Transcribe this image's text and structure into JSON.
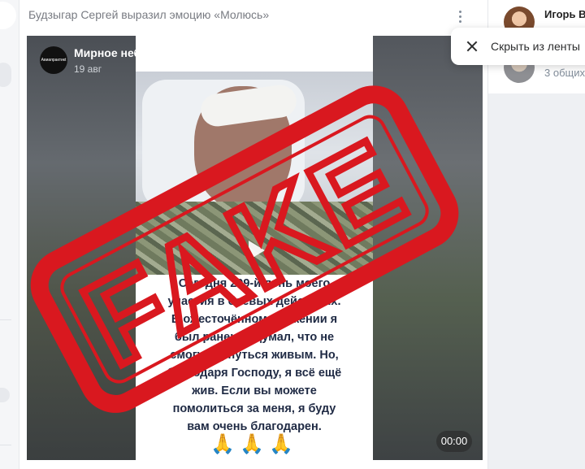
{
  "post": {
    "header_text": "Будзыгар Сергей выразил эмоцию «Молюсь»",
    "source_name": "Мирное небо",
    "source_date": "19 авг",
    "source_avatar_text": "Авиапрактикt",
    "caption_lines": [
      "Сегодня 299-й день моего",
      "участия в боевых действиях.",
      "В ожесточённом сражении я",
      "был ранен, и думал, что не",
      "смогу вернуться живым. Но,",
      "благодаря Господу, я всё ещё",
      "жив. Если вы можете",
      "помолиться за меня, я буду",
      "вам очень благодарен."
    ],
    "emoji": "🙏🙏🙏",
    "video_time": "00:00"
  },
  "stamp": {
    "text": "FAKE",
    "color": "#d9181f"
  },
  "menu": {
    "hide_label": "Скрыть из ленты"
  },
  "friend": {
    "name": "Игорь В",
    "mutual": "3 общих"
  },
  "colors": {
    "accent": "#2c2d2e",
    "muted": "#818c99"
  }
}
